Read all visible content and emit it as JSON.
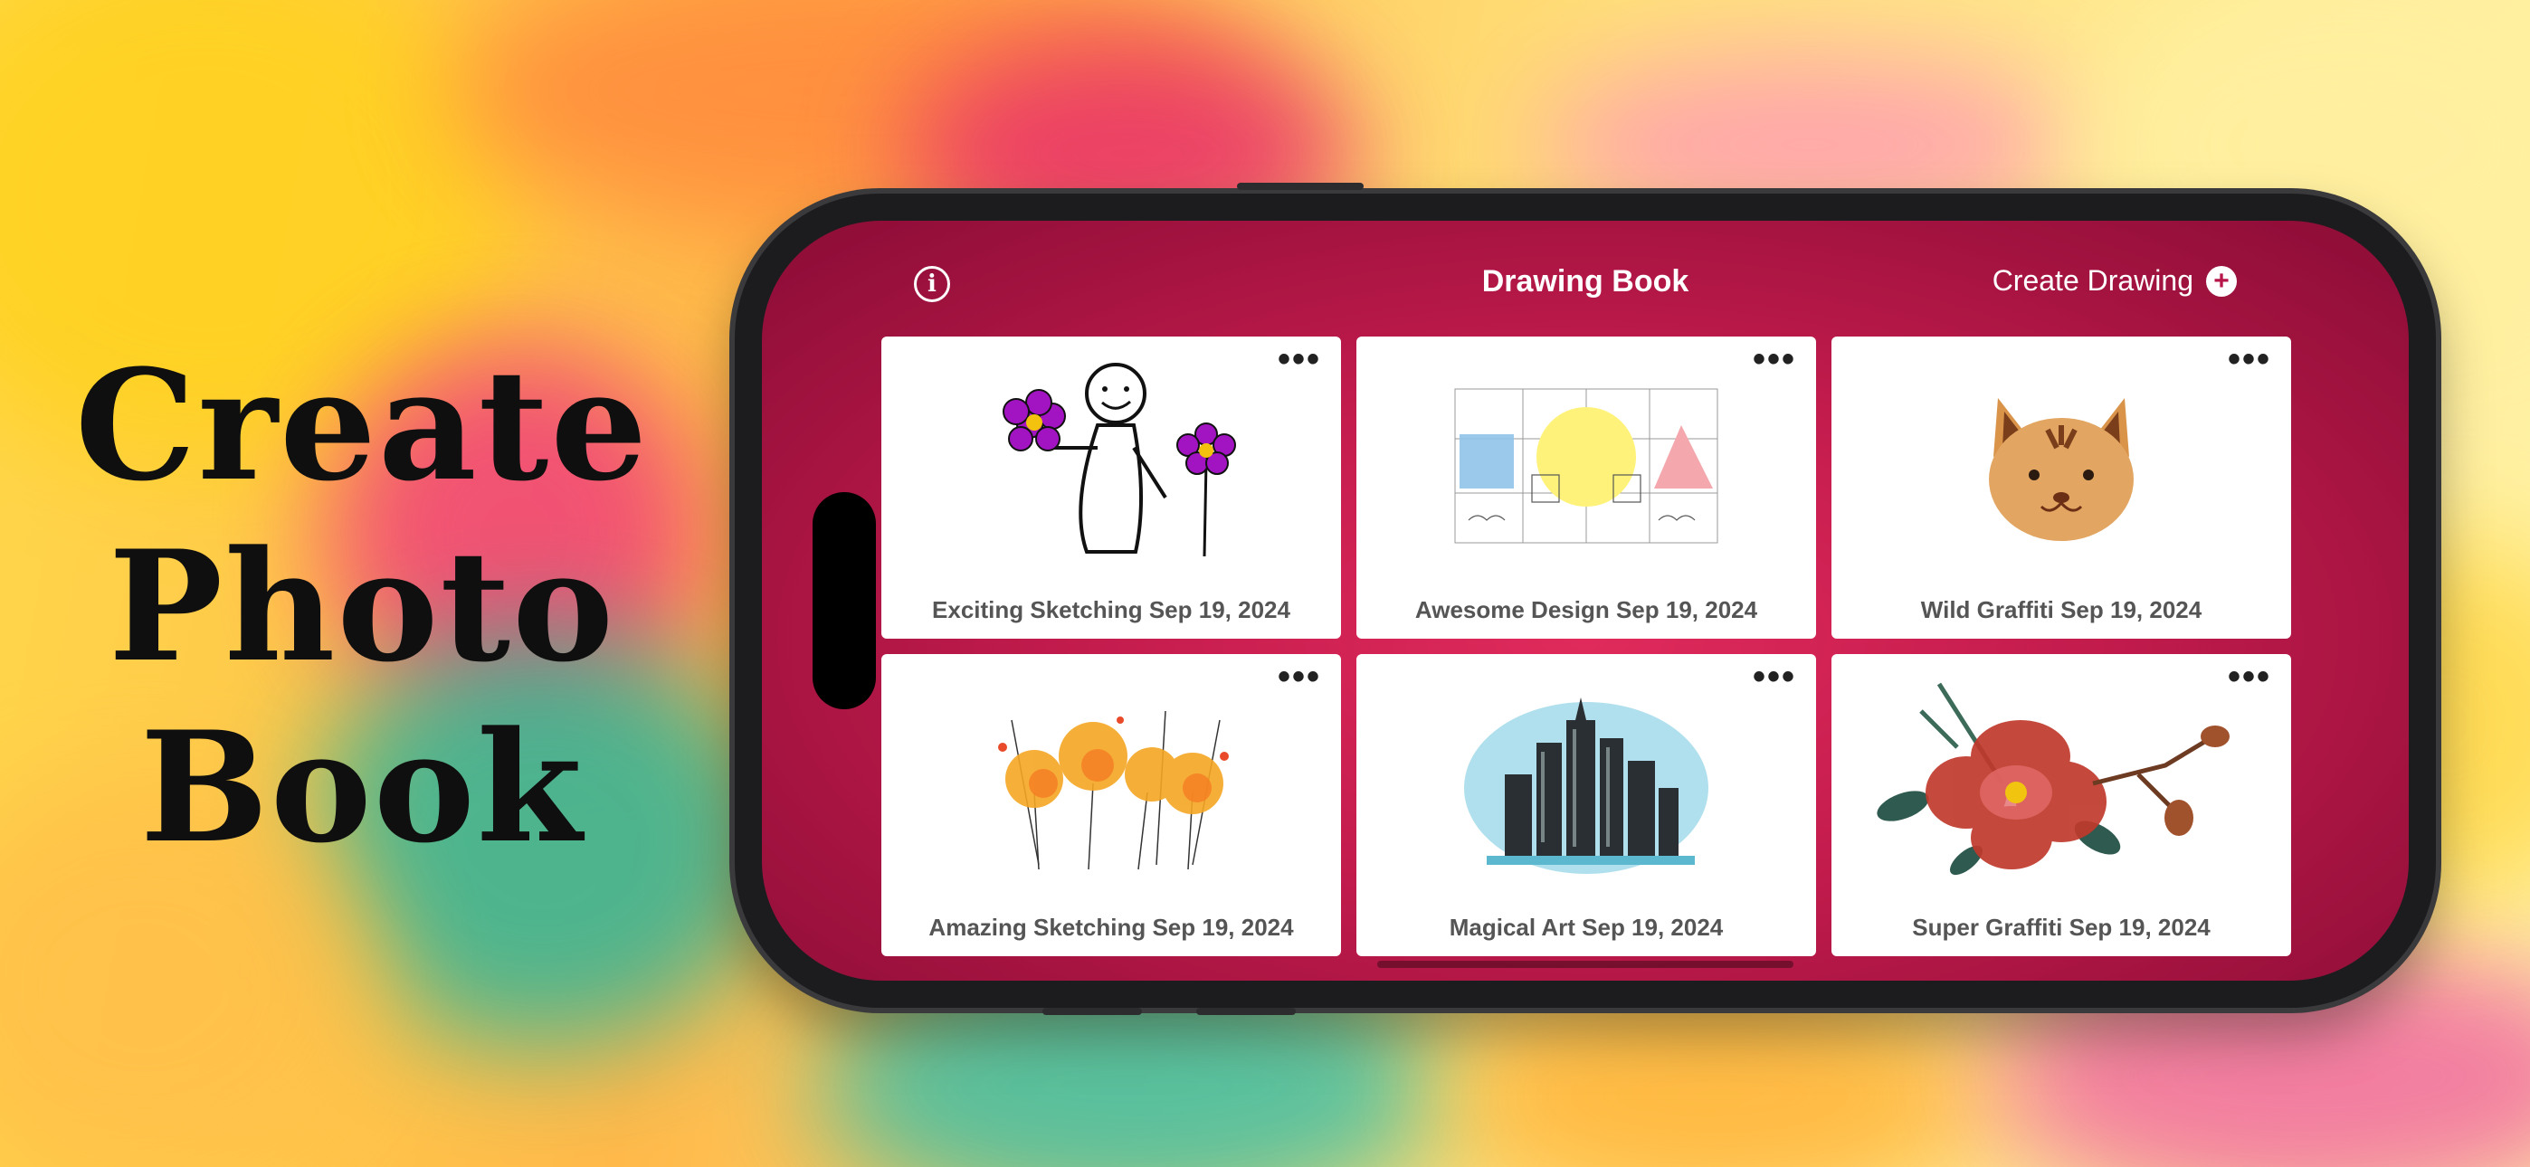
{
  "headline": {
    "line1": "Create",
    "line2": "Photo",
    "line3": "Book"
  },
  "app": {
    "title": "Drawing Book",
    "create_label": "Create Drawing",
    "info_glyph": "i",
    "plus_glyph": "+",
    "more_glyph": "•••"
  },
  "drawings": [
    {
      "label": "Exciting Sketching Sep 19, 2024",
      "icon": "stick-figure-flowers"
    },
    {
      "label": "Awesome Design Sep 19, 2024",
      "icon": "shapes-sketch"
    },
    {
      "label": "Wild Graffiti Sep 19, 2024",
      "icon": "cat-face"
    },
    {
      "label": "Amazing Sketching Sep 19, 2024",
      "icon": "orange-flowers"
    },
    {
      "label": "Magical Art Sep 19, 2024",
      "icon": "city-skyline"
    },
    {
      "label": "Super Graffiti Sep 19, 2024",
      "icon": "red-flower-bouquet"
    }
  ],
  "colors": {
    "accent": "#c11b4c",
    "card": "#ffffff"
  }
}
